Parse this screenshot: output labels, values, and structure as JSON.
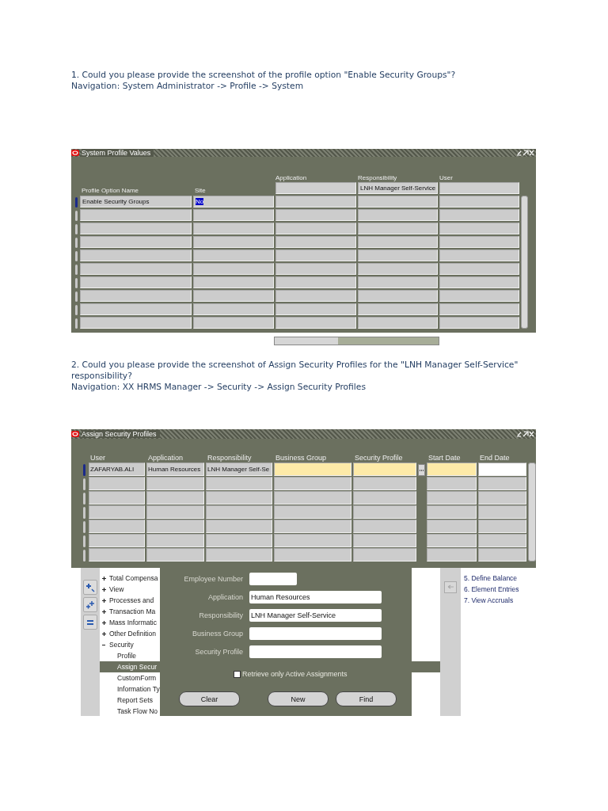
{
  "questions": [
    {
      "text": "1. Could you please provide the screenshot of the profile option \"Enable Security Groups\"?",
      "navigation": "Navigation: System Administrator -> Profile -> System"
    },
    {
      "text": "2. Could you please provide the screenshot of Assign Security Profiles for the \"LNH Manager Self-Service\" responsibility?",
      "navigation": "Navigation: XX HRMS Manager -> Security -> Assign Security Profiles"
    }
  ],
  "profile_window": {
    "title": "System Profile Values",
    "columns": [
      {
        "label": "Profile Option Name",
        "kind": "plain"
      },
      {
        "label": "Site",
        "kind": "plain"
      },
      {
        "label": "Application",
        "kind": "context"
      },
      {
        "label": "Responsibility",
        "kind": "context",
        "context": "LNH Manager Self-Service"
      },
      {
        "label": "User",
        "kind": "context"
      }
    ],
    "rows": [
      {
        "cells": [
          {
            "text": "Enable Security Groups",
            "selected": false
          },
          {
            "text": "No",
            "selected": true
          }
        ]
      }
    ]
  },
  "assign_window": {
    "title": "Assign Security Profiles",
    "columns": [
      {
        "label": "User",
        "kind": "readonly"
      },
      {
        "label": "Application",
        "kind": "readonly"
      },
      {
        "label": "Responsibility",
        "kind": "readonly"
      },
      {
        "label": "Business Group",
        "kind": "required"
      },
      {
        "label": "Security Profile",
        "kind": "lov"
      },
      {
        "label": "Start Date",
        "kind": "required"
      },
      {
        "label": "End Date",
        "kind": "optional"
      }
    ],
    "rows": [
      {
        "cells": [
          "ZAFARYAB.ALI",
          "Human Resources",
          "LNH Manager Self-Se"
        ]
      }
    ]
  },
  "navigator": {
    "tree": [
      {
        "label": "Total Compensa",
        "expanded": false,
        "selected": false
      },
      {
        "label": "View",
        "expanded": false,
        "selected": false
      },
      {
        "label": "Processes and",
        "expanded": false,
        "selected": false
      },
      {
        "label": "Transaction Ma",
        "expanded": false,
        "selected": false
      },
      {
        "label": "Mass Informatic",
        "expanded": false,
        "selected": false
      },
      {
        "label": "Other Definition",
        "expanded": false,
        "selected": false
      },
      {
        "label": "Security",
        "expanded": true,
        "selected": false,
        "children": [
          {
            "label": "Profile",
            "selected": false
          },
          {
            "label": "Assign Secur",
            "selected": true
          },
          {
            "label": "CustomForm",
            "selected": false
          },
          {
            "label": "Information Ty",
            "selected": false
          },
          {
            "label": "Report Sets",
            "selected": false
          },
          {
            "label": "Task Flow No",
            "selected": false
          }
        ]
      }
    ],
    "top_ten": [
      "5. Define Balance",
      "6. Element Entries",
      "7. View Accruals"
    ]
  },
  "find_dialog": {
    "fields": [
      {
        "label": "Employee Number",
        "short": true
      },
      {
        "label": "Application",
        "value": "Human Resources",
        "short": false
      },
      {
        "label": "Responsibility",
        "value": "LNH Manager Self-Service",
        "short": false
      },
      {
        "label": "Business Group",
        "short": false
      },
      {
        "label": "Security Profile",
        "short": false
      }
    ],
    "checkbox": {
      "label": "Retrieve only Active Assignments",
      "checked": false
    },
    "buttons": [
      "Clear",
      "New",
      "Find"
    ]
  }
}
